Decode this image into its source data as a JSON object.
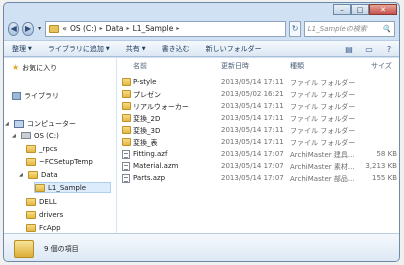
{
  "window": {
    "buttons": {
      "minimize": "–",
      "maximize": "□",
      "close": "✕"
    }
  },
  "address": {
    "back_icon": "back-arrow-icon",
    "forward_icon": "forward-arrow-icon",
    "prefix": "«",
    "segments": [
      "OS (C:)",
      "Data",
      "L1_Sample"
    ],
    "separator": "▸",
    "search_placeholder": "L1_Sampleの検索",
    "search_icon": "🔍",
    "refresh_glyph": "↻"
  },
  "toolbar": {
    "organize": "整理",
    "add_to_library": "ライブラリに追加",
    "share": "共有",
    "burn": "書き込む",
    "new_folder": "新しいフォルダー",
    "view_icon": "▤",
    "pane_icon": "▭",
    "help_icon": "?"
  },
  "nav": {
    "favorites": "お気に入り",
    "libraries": "ライブラリ",
    "computer": "コンピューター",
    "drive": "OS (C:)",
    "folders": [
      "_rpcs",
      "~FCSetupTemp",
      "Data",
      "L1_Sample",
      "DELL",
      "drivers",
      "FcApp"
    ]
  },
  "columns": {
    "name": "名前",
    "date": "更新日時",
    "type": "種類",
    "size": "サイズ"
  },
  "files": [
    {
      "name": "P-style",
      "date": "2013/05/14 17:11",
      "type": "ファイル フォルダー",
      "size": "",
      "kind": "folder"
    },
    {
      "name": "プレゼン",
      "date": "2013/05/02 16:21",
      "type": "ファイル フォルダー",
      "size": "",
      "kind": "folder"
    },
    {
      "name": "リアルウォーカー",
      "date": "2013/05/14 17:11",
      "type": "ファイル フォルダー",
      "size": "",
      "kind": "folder"
    },
    {
      "name": "変換_2D",
      "date": "2013/05/14 17:11",
      "type": "ファイル フォルダー",
      "size": "",
      "kind": "folder"
    },
    {
      "name": "変換_3D",
      "date": "2013/05/14 17:11",
      "type": "ファイル フォルダー",
      "size": "",
      "kind": "folder"
    },
    {
      "name": "変換_表",
      "date": "2013/05/14 17:11",
      "type": "ファイル フォルダー",
      "size": "",
      "kind": "folder"
    },
    {
      "name": "Fitting.azf",
      "date": "2013/05/14 17:07",
      "type": "ArchiMaster 建具...",
      "size": "58 KB",
      "kind": "file"
    },
    {
      "name": "Material.azm",
      "date": "2013/05/14 17:07",
      "type": "ArchiMaster 素材...",
      "size": "3,213 KB",
      "kind": "file"
    },
    {
      "name": "Parts.azp",
      "date": "2013/05/14 17:07",
      "type": "ArchiMaster 部品...",
      "size": "155 KB",
      "kind": "file"
    }
  ],
  "status": {
    "item_count": "9 個の項目"
  }
}
